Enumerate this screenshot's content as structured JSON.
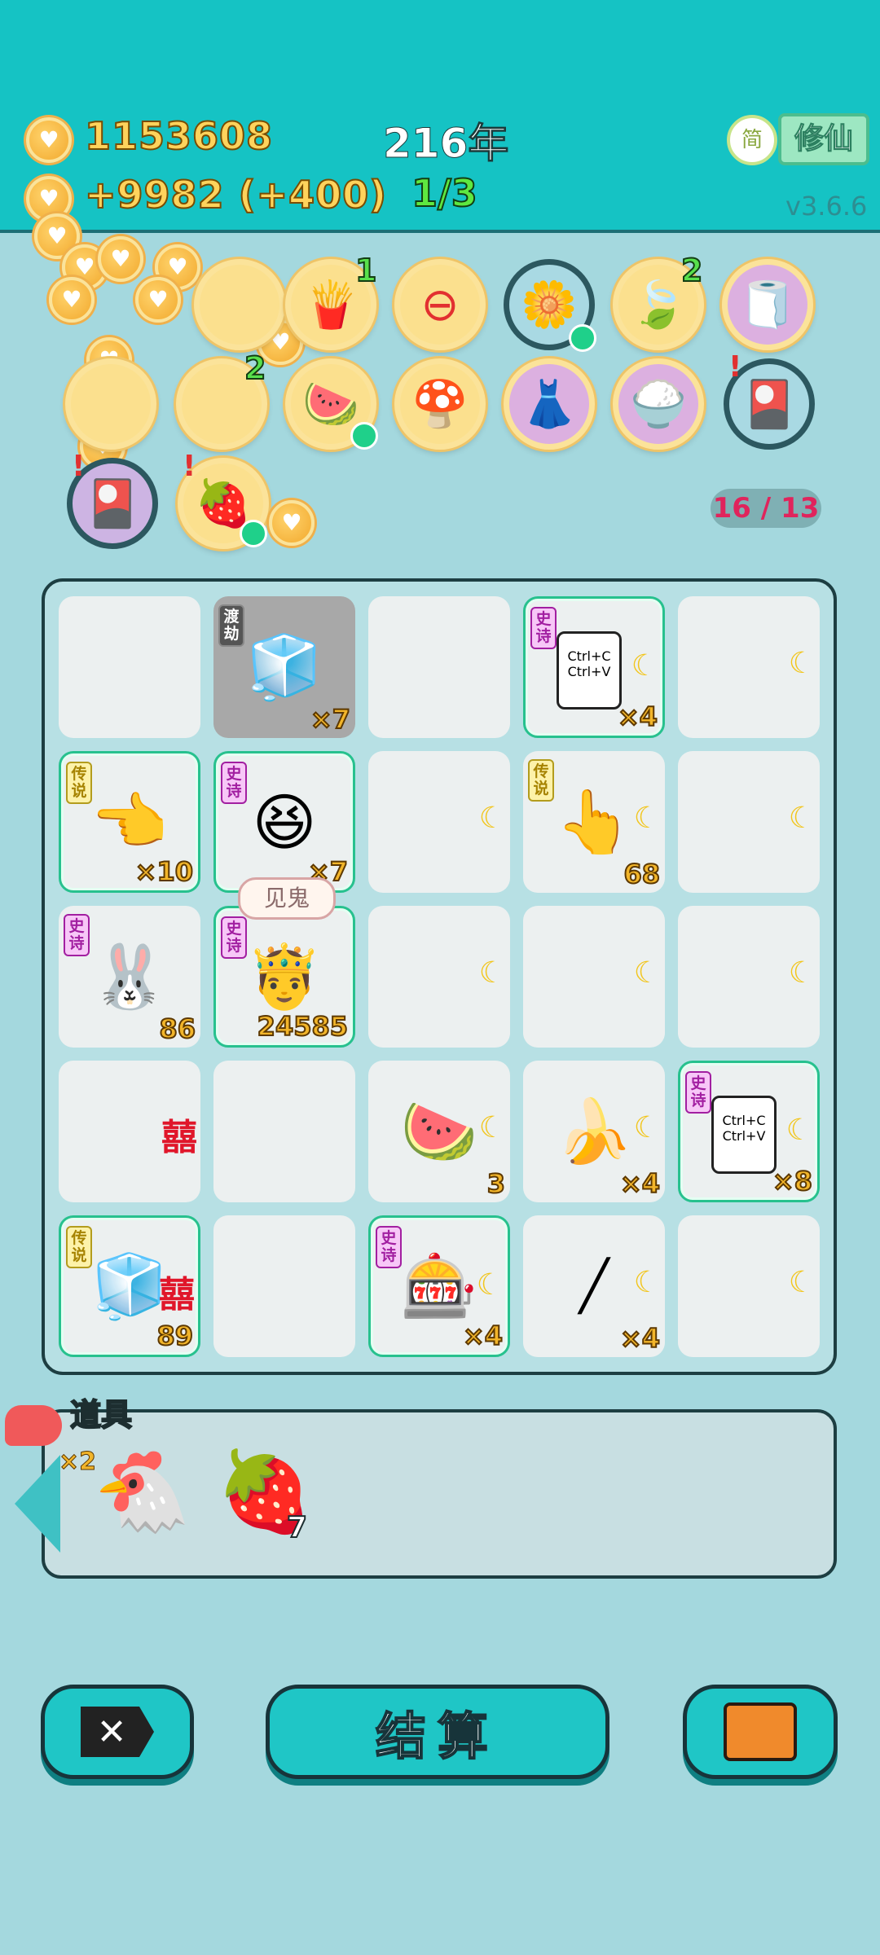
{
  "header": {
    "gold": "1153608",
    "income": "+9982 (+400)",
    "year": "216年",
    "stage": "1/3",
    "mode_icon_text": "简",
    "mode_button": "修仙",
    "version": "v3.6.6"
  },
  "relic_badges": {
    "fries": "1",
    "leaf": "2",
    "row2_second": "2"
  },
  "board_counter": "16 / 13",
  "cells": {
    "fridge": {
      "tag": "渡劫",
      "count": "×7"
    },
    "ctrl_top": {
      "tag": "史诗",
      "count": "×4",
      "text": "Ctrl+C Ctrl+V"
    },
    "hand1": {
      "tag": "传说",
      "count": "×10"
    },
    "face_green": {
      "tag": "史诗",
      "count": "×7"
    },
    "hand2": {
      "tag": "传说",
      "count": "68"
    },
    "rabbit_house": {
      "tag": "史诗",
      "count": "86"
    },
    "face_crown": {
      "tag": "史诗",
      "count": "24585"
    },
    "bubble": "见鬼",
    "xi1": "囍",
    "watermelon": {
      "count": "3"
    },
    "banana": {
      "count": "×4"
    },
    "ctrl_mid": {
      "tag": "史诗",
      "count": "×8",
      "text": "Ctrl+C Ctrl+V"
    },
    "fridge2": {
      "tag": "传说",
      "count": "89",
      "xi": "囍"
    },
    "capsule": {
      "tag": "史诗",
      "count": "×4"
    },
    "straw": {
      "count": "×4"
    }
  },
  "props": {
    "title": "道具",
    "liver_count": "×2",
    "berry_count": "7"
  },
  "buttons": {
    "settle": "结算"
  }
}
